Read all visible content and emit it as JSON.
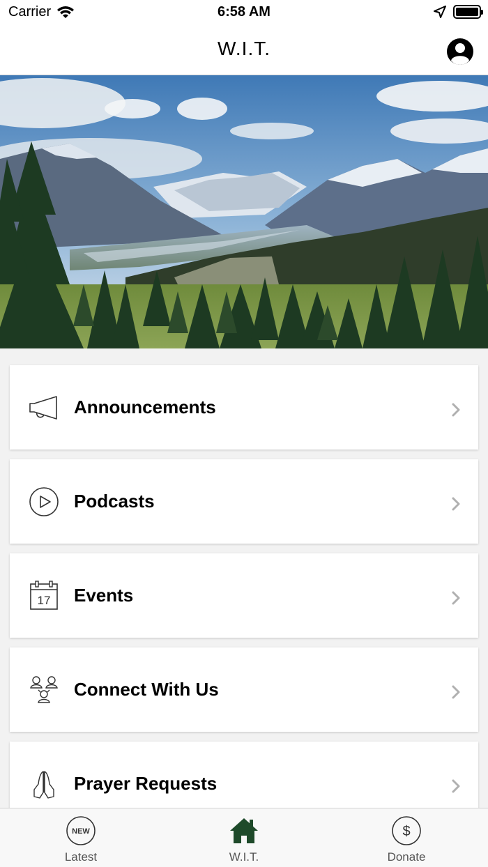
{
  "status_bar": {
    "carrier": "Carrier",
    "time": "6:58 AM"
  },
  "nav": {
    "title": "W.I.T."
  },
  "menu": {
    "items": [
      {
        "label": "Announcements",
        "icon": "megaphone-icon"
      },
      {
        "label": "Podcasts",
        "icon": "play-circle-icon"
      },
      {
        "label": "Events",
        "icon": "calendar-icon",
        "calendar_day": "17"
      },
      {
        "label": "Connect With Us",
        "icon": "people-group-icon"
      },
      {
        "label": "Prayer Requests",
        "icon": "praying-hands-icon"
      }
    ]
  },
  "tabs": [
    {
      "label": "Latest",
      "icon": "new-badge-icon",
      "icon_text": "NEW"
    },
    {
      "label": "W.I.T.",
      "icon": "home-icon",
      "active": true
    },
    {
      "label": "Donate",
      "icon": "dollar-circle-icon",
      "icon_text": "$"
    }
  ],
  "colors": {
    "accent_green": "#1e4a2a",
    "card_bg": "#ffffff",
    "page_bg": "#f2f2f2"
  }
}
